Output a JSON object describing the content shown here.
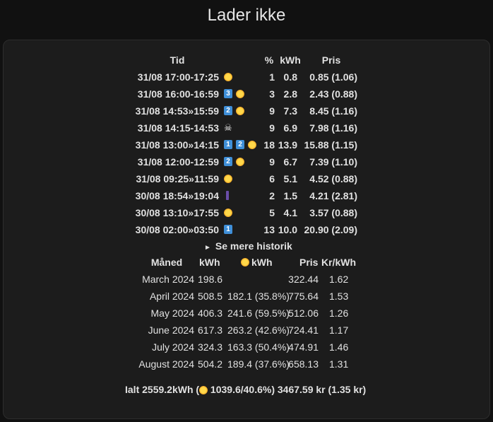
{
  "title": "Lader ikke",
  "sessions": {
    "headers": {
      "tid": "Tid",
      "pct": "%",
      "kwh": "kWh",
      "pris": "Pris"
    },
    "rows": [
      {
        "tid": "31/08 17:00-17:25",
        "badges": [],
        "sun": true,
        "skull": false,
        "plug": false,
        "pct": "1",
        "kwh": "0.8",
        "pris": "0.85 (1.06)"
      },
      {
        "tid": "31/08 16:00-16:59",
        "badges": [
          "3"
        ],
        "sun": true,
        "skull": false,
        "plug": false,
        "pct": "3",
        "kwh": "2.8",
        "pris": "2.43 (0.88)"
      },
      {
        "tid": "31/08 14:53»15:59",
        "badges": [
          "2"
        ],
        "sun": true,
        "skull": false,
        "plug": false,
        "pct": "9",
        "kwh": "7.3",
        "pris": "8.45 (1.16)"
      },
      {
        "tid": "31/08 14:15-14:53",
        "badges": [],
        "sun": false,
        "skull": true,
        "plug": false,
        "pct": "9",
        "kwh": "6.9",
        "pris": "7.98 (1.16)"
      },
      {
        "tid": "31/08 13:00»14:15",
        "badges": [
          "1",
          "2"
        ],
        "sun": true,
        "skull": false,
        "plug": false,
        "pct": "18",
        "kwh": "13.9",
        "pris": "15.88 (1.15)"
      },
      {
        "tid": "31/08 12:00-12:59",
        "badges": [
          "2"
        ],
        "sun": true,
        "skull": false,
        "plug": false,
        "pct": "9",
        "kwh": "6.7",
        "pris": "7.39 (1.10)"
      },
      {
        "tid": "31/08 09:25»11:59",
        "badges": [],
        "sun": true,
        "skull": false,
        "plug": false,
        "pct": "6",
        "kwh": "5.1",
        "pris": "4.52 (0.88)"
      },
      {
        "tid": "30/08 18:54»19:04",
        "badges": [],
        "sun": false,
        "skull": false,
        "plug": true,
        "pct": "2",
        "kwh": "1.5",
        "pris": "4.21 (2.81)"
      },
      {
        "tid": "30/08 13:10»17:55",
        "badges": [],
        "sun": true,
        "skull": false,
        "plug": false,
        "pct": "5",
        "kwh": "4.1",
        "pris": "3.57 (0.88)"
      },
      {
        "tid": "30/08 02:00»03:50",
        "badges": [
          "1"
        ],
        "sun": false,
        "skull": false,
        "plug": false,
        "pct": "13",
        "kwh": "10.0",
        "pris": "20.90 (2.09)"
      }
    ],
    "more_history": "Se mere historik",
    "skull_glyph": "☠",
    "more_glyph": "►"
  },
  "monthly": {
    "headers": {
      "maaned": "Måned",
      "kwh": "kWh",
      "sun_kwh": "kWh",
      "pris": "Pris",
      "kr_kwh": "Kr/kWh"
    },
    "rows": [
      {
        "maaned": "March 2024",
        "kwh": "198.6",
        "sun_kwh": "",
        "pris": "322.44",
        "kr_kwh": "1.62"
      },
      {
        "maaned": "April 2024",
        "kwh": "508.5",
        "sun_kwh": "182.1 (35.8%)",
        "pris": "775.64",
        "kr_kwh": "1.53"
      },
      {
        "maaned": "May 2024",
        "kwh": "406.3",
        "sun_kwh": "241.6 (59.5%)",
        "pris": "512.06",
        "kr_kwh": "1.26"
      },
      {
        "maaned": "June 2024",
        "kwh": "617.3",
        "sun_kwh": "263.2 (42.6%)",
        "pris": "724.41",
        "kr_kwh": "1.17"
      },
      {
        "maaned": "July 2024",
        "kwh": "324.3",
        "sun_kwh": "163.3 (50.4%)",
        "pris": "474.91",
        "kr_kwh": "1.46"
      },
      {
        "maaned": "August 2024",
        "kwh": "504.2",
        "sun_kwh": "189.4 (37.6%)",
        "pris": "658.13",
        "kr_kwh": "1.31"
      }
    ]
  },
  "total": {
    "prefix": "Ialt 2559.2kWh (",
    "suffix": " 1039.6/40.6%) 3467.59 kr (1.35 kr)"
  },
  "colors": {
    "badge": "#3f8fd8",
    "sun": "#f5c518",
    "background": "#111111",
    "card": "#1c1c1c"
  }
}
